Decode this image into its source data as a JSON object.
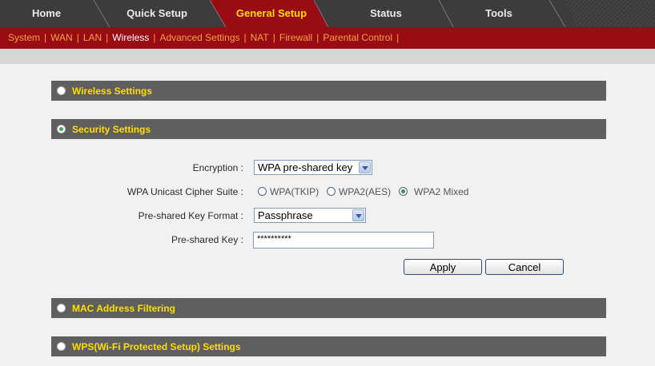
{
  "top_tabs": [
    {
      "label": "Home",
      "active": false
    },
    {
      "label": "Quick Setup",
      "active": false
    },
    {
      "label": "General Setup",
      "active": true
    },
    {
      "label": "Status",
      "active": false
    },
    {
      "label": "Tools",
      "active": false
    }
  ],
  "sub_nav": {
    "items": [
      "System",
      "WAN",
      "LAN",
      "Wireless",
      "Advanced Settings",
      "NAT",
      "Firewall",
      "Parental Control"
    ],
    "active": "Wireless",
    "separator": "|"
  },
  "sections": {
    "wireless_settings": {
      "title": "Wireless Settings",
      "selected": false
    },
    "security_settings": {
      "title": "Security Settings",
      "selected": true
    },
    "mac_filtering": {
      "title": "MAC Address Filtering",
      "selected": false
    },
    "wps": {
      "title": "WPS(Wi-Fi Protected Setup) Settings",
      "selected": false
    }
  },
  "form": {
    "encryption": {
      "label": "Encryption :",
      "value": "WPA pre-shared key"
    },
    "cipher_suite": {
      "label": "WPA Unicast Cipher Suite :",
      "options": [
        "WPA(TKIP)",
        "WPA2(AES)",
        "WPA2 Mixed"
      ],
      "selected": "WPA2 Mixed"
    },
    "key_format": {
      "label": "Pre-shared Key Format :",
      "value": "Passphrase"
    },
    "psk": {
      "label": "Pre-shared Key :",
      "value": "**********"
    }
  },
  "buttons": {
    "apply": "Apply",
    "cancel": "Cancel"
  },
  "colors": {
    "tab_bar": "#3c3c3c",
    "active_tab": "#9a0c14",
    "active_tab_text": "#ffde00",
    "subnav_bg": "#9a0c14",
    "subnav_text": "#f4a23c",
    "section_bar": "#5f5f5f",
    "section_title": "#ffde00"
  }
}
